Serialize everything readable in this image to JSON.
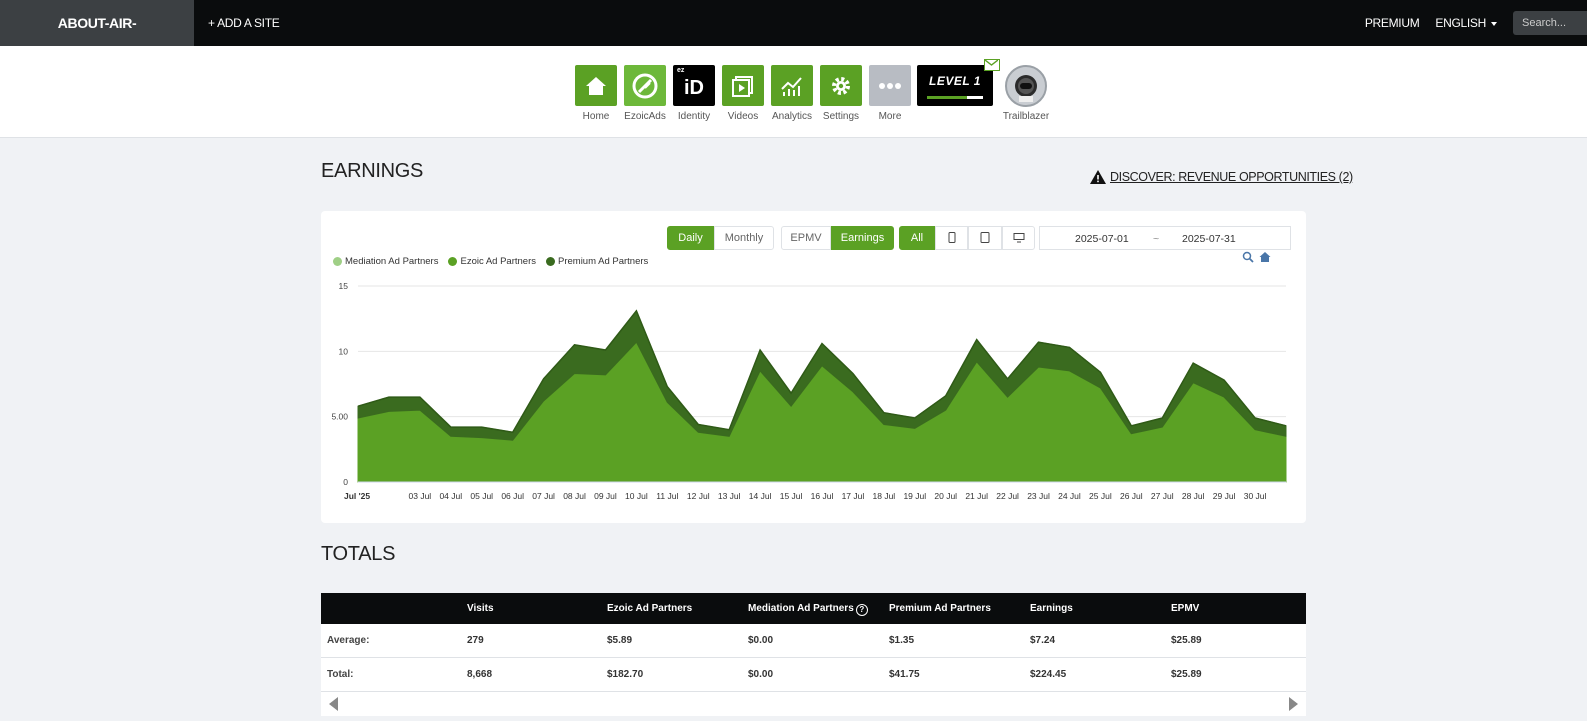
{
  "topbar": {
    "site_name": "ABOUT-AIR-COMPRESSORS.COM",
    "add_site": "+ ADD A SITE",
    "premium": "PREMIUM",
    "language": "ENGLISH",
    "search_placeholder": "Search..."
  },
  "apps": [
    {
      "label": "Home",
      "icon": "home-icon"
    },
    {
      "label": "EzoicAds",
      "icon": "ezoicads-icon"
    },
    {
      "label": "Identity",
      "icon": "identity-icon"
    },
    {
      "label": "Videos",
      "icon": "videos-icon"
    },
    {
      "label": "Analytics",
      "icon": "analytics-icon"
    },
    {
      "label": "Settings",
      "icon": "gear-icon"
    },
    {
      "label": "More",
      "icon": "more-icon"
    }
  ],
  "identity_tile": {
    "badge": "ez",
    "text": "iD"
  },
  "level": {
    "label": "LEVEL 1",
    "progress": 0.72
  },
  "trailblazer": {
    "label": "Trailblazer"
  },
  "earnings": {
    "title": "EARNINGS",
    "discover": "DISCOVER: REVENUE OPPORTUNITIES (2)",
    "period_buttons": [
      "Daily",
      "Monthly"
    ],
    "metric_buttons": [
      "EPMV",
      "Earnings"
    ],
    "device_all": "All",
    "date_from": "2025-07-01",
    "date_sep": "~",
    "date_to": "2025-07-31"
  },
  "colors": {
    "mediation": "#9fcf86",
    "ezoic": "#5ba124",
    "premium": "#3a6b1f",
    "accent": "#5ba124"
  },
  "chart_data": {
    "type": "area",
    "stacked": true,
    "ylim": [
      0,
      15
    ],
    "y_ticks": [
      "0",
      "5.00",
      "10",
      "15"
    ],
    "x_labels": [
      "Jul '25",
      "03 Jul",
      "04 Jul",
      "05 Jul",
      "06 Jul",
      "07 Jul",
      "08 Jul",
      "09 Jul",
      "10 Jul",
      "11 Jul",
      "12 Jul",
      "13 Jul",
      "14 Jul",
      "15 Jul",
      "16 Jul",
      "17 Jul",
      "18 Jul",
      "19 Jul",
      "20 Jul",
      "21 Jul",
      "22 Jul",
      "23 Jul",
      "24 Jul",
      "25 Jul",
      "26 Jul",
      "27 Jul",
      "28 Jul",
      "29 Jul",
      "30 Jul"
    ],
    "x_days": [
      1,
      3,
      4,
      5,
      6,
      7,
      8,
      9,
      10,
      11,
      12,
      13,
      14,
      15,
      16,
      17,
      18,
      19,
      20,
      21,
      22,
      23,
      24,
      25,
      26,
      27,
      28,
      29,
      30
    ],
    "days": [
      1,
      2,
      3,
      4,
      5,
      6,
      7,
      8,
      9,
      10,
      11,
      12,
      13,
      14,
      15,
      16,
      17,
      18,
      19,
      20,
      21,
      22,
      23,
      24,
      25,
      26,
      27,
      28,
      29,
      30,
      31
    ],
    "legend": [
      "Mediation Ad Partners",
      "Ezoic Ad Partners",
      "Premium Ad Partners"
    ],
    "series": [
      {
        "name": "Mediation Ad Partners",
        "values": [
          0,
          0,
          0,
          0,
          0,
          0,
          0,
          0,
          0,
          0,
          0,
          0,
          0,
          0,
          0,
          0,
          0,
          0,
          0,
          0,
          0,
          0,
          0,
          0,
          0,
          0,
          0,
          0,
          0,
          0,
          0
        ]
      },
      {
        "name": "Ezoic Ad Partners",
        "values": [
          4.9,
          5.4,
          5.5,
          3.5,
          3.4,
          3.2,
          6.2,
          8.3,
          8.2,
          10.7,
          6.1,
          3.8,
          3.5,
          8.5,
          5.8,
          8.9,
          6.9,
          4.4,
          4.1,
          5.5,
          9.2,
          6.5,
          8.8,
          8.5,
          7.2,
          3.7,
          4.2,
          7.6,
          6.5,
          4.0,
          3.5
        ]
      },
      {
        "name": "Premium Ad Partners",
        "values": [
          0.9,
          1.1,
          1.0,
          0.7,
          0.8,
          0.6,
          1.7,
          2.2,
          1.9,
          2.4,
          1.2,
          0.6,
          0.5,
          1.6,
          1.0,
          1.7,
          1.4,
          0.9,
          0.8,
          1.1,
          1.7,
          1.4,
          1.9,
          1.8,
          1.2,
          0.6,
          0.7,
          1.5,
          1.3,
          0.9,
          0.8
        ]
      }
    ]
  },
  "totals": {
    "title": "TOTALS",
    "headers": [
      "",
      "Visits",
      "Ezoic Ad Partners",
      "Mediation Ad Partners",
      "Premium Ad Partners",
      "Earnings",
      "EPMV"
    ],
    "rows": [
      [
        "Average:",
        "279",
        "$5.89",
        "$0.00",
        "$1.35",
        "$7.24",
        "$25.89"
      ],
      [
        "Total:",
        "8,668",
        "$182.70",
        "$0.00",
        "$41.75",
        "$224.45",
        "$25.89"
      ]
    ]
  }
}
